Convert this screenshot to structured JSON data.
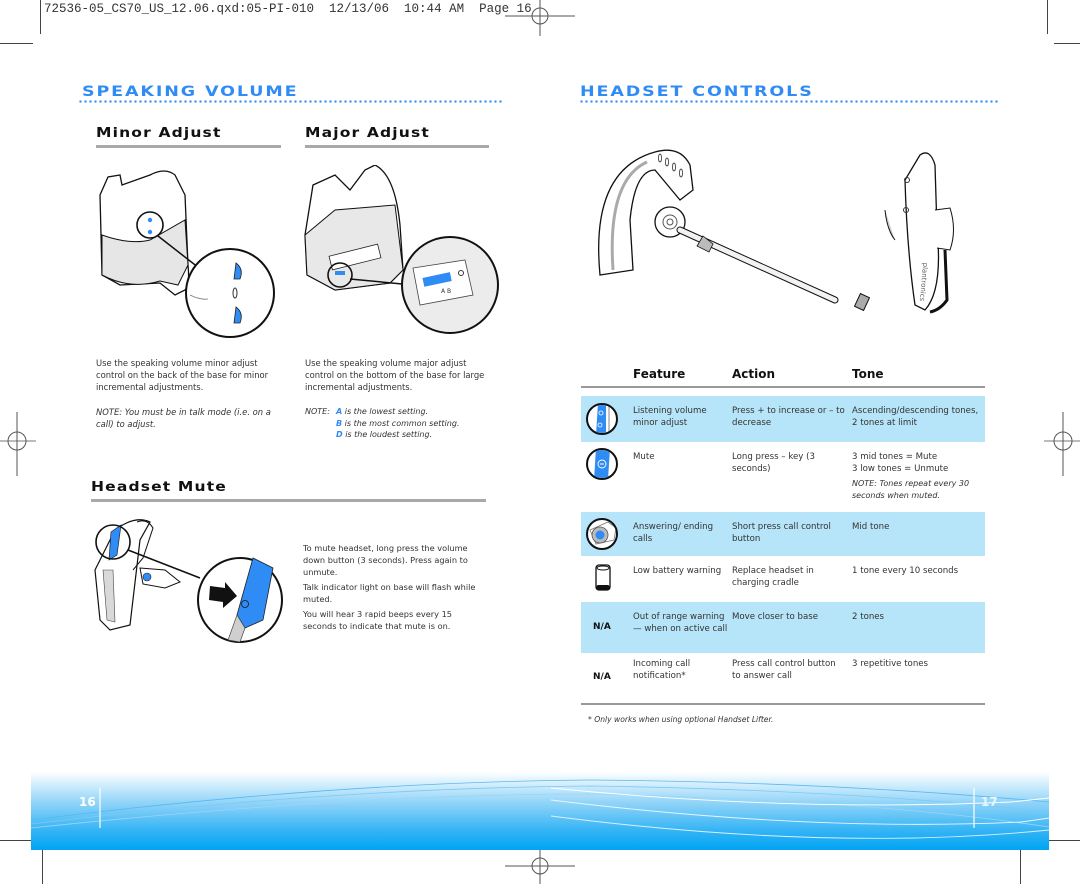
{
  "slug": "72536-05_CS70_US_12.06.qxd:05-PI-010  12/13/06  10:44 AM  Page 16",
  "left_page": {
    "section_title": "SPEAKING VOLUME",
    "minor": {
      "title": "Minor Adjust",
      "body": "Use the speaking volume minor adjust control on the back of the base for minor incremental adjustments.",
      "note": "NOTE: You must be in talk mode (i.e. on a call) to adjust."
    },
    "major": {
      "title": "Major Adjust",
      "body": "Use the speaking volume major adjust control on the bottom of the base for large incremental adjustments.",
      "note_prefix": "NOTE:",
      "settings": [
        {
          "letter": "A",
          "text": "is the lowest setting."
        },
        {
          "letter": "B",
          "text": "is the most common setting."
        },
        {
          "letter": "D",
          "text": "is the loudest setting."
        }
      ]
    },
    "mute": {
      "title": "Headset Mute",
      "paragraphs": [
        "To mute headset, long press the volume down button (3 seconds). Press again to unmute.",
        "Talk indicator light on base will flash while muted.",
        "You will hear 3 rapid beeps every 15 seconds to indicate that mute is on."
      ]
    },
    "page_number": "16"
  },
  "right_page": {
    "section_title": "HEADSET CONTROLS",
    "table": {
      "headers": [
        "Feature",
        "Action",
        "Tone"
      ],
      "rows": [
        {
          "icon": "volume-buttons-icon",
          "feature": "Listening volume minor adjust",
          "action": "Press + to increase or – to decrease",
          "tone": "Ascending/descending tones, 2 tones at limit",
          "note": ""
        },
        {
          "icon": "mute-button-icon",
          "feature": "Mute",
          "action": "Long press – key (3 seconds)",
          "tone": "3 mid tones  = Mute\n3 low tones  = Unmute",
          "note": "NOTE: Tones repeat every 30 seconds when muted."
        },
        {
          "icon": "call-control-button-icon",
          "feature": "Answering/ ending calls",
          "action": "Short press call control button",
          "tone": "Mid tone",
          "note": ""
        },
        {
          "icon": "battery-icon",
          "feature": "Low battery warning",
          "action": "Replace headset in charging cradle",
          "tone": "1 tone every 10 seconds",
          "note": ""
        },
        {
          "icon_text": "N/A",
          "feature": "Out of range warning — when on active call",
          "action": "Move closer to base",
          "tone": "2 tones",
          "note": ""
        },
        {
          "icon_text": "N/A",
          "feature": "Incoming call notification*",
          "action": "Press call control button to answer call",
          "tone": "3 repetitive tones",
          "note": ""
        }
      ]
    },
    "footnote": "* Only works when using optional Handset Lifter.",
    "page_number": "17"
  },
  "colors": {
    "accent": "#2f8cf5",
    "highlight_row": "#b6e4f8",
    "footer_band": "#00a4f3"
  }
}
